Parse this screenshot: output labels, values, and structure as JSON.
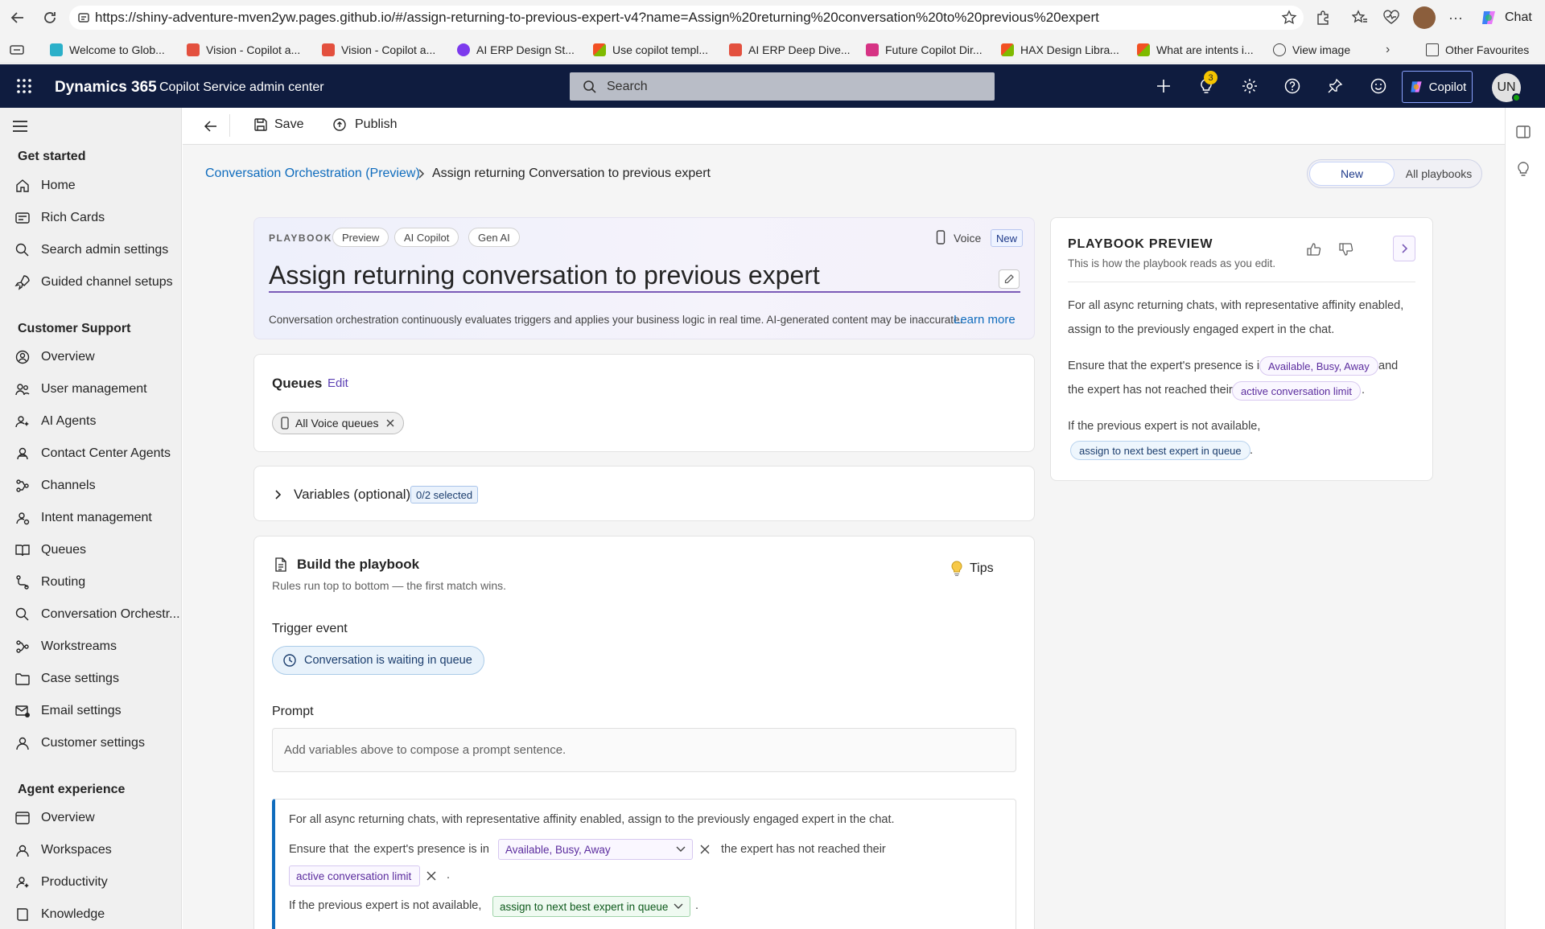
{
  "browser": {
    "url": "https://shiny-adventure-mven2yw.pages.github.io/#/assign-returning-to-previous-expert-v4?name=Assign%20returning%20conversation%20to%20previous%20expert",
    "chat_label": "Chat",
    "bookmarks": [
      {
        "label": "Welcome to Glob...",
        "color": "#2bb0c9"
      },
      {
        "label": "Vision - Copilot a...",
        "color": "#e3503e"
      },
      {
        "label": "Vision - Copilot a...",
        "color": "#e3503e"
      },
      {
        "label": "AI ERP Design St...",
        "color": "#7c3aed"
      },
      {
        "label": "Use copilot templ...",
        "color": "#f25022"
      },
      {
        "label": "AI ERP Deep Dive...",
        "color": "#e3503e"
      },
      {
        "label": "Future Copilot Dir...",
        "color": "#d63384"
      },
      {
        "label": "HAX Design Libra...",
        "color": "#f25022"
      },
      {
        "label": "What are intents i...",
        "color": "#f25022"
      },
      {
        "label": "View image",
        "color": "#424242"
      }
    ],
    "other_favourites": "Other Favourites",
    "notification_count": "3"
  },
  "header": {
    "product": "Dynamics 365",
    "app": "Copilot Service admin center",
    "search_placeholder": "Search",
    "copilot_label": "Copilot",
    "avatar_initials": "UN"
  },
  "sidebar": {
    "sections": [
      {
        "title": "Get started",
        "items": [
          "Home",
          "Rich Cards",
          "Search admin settings",
          "Guided channel setups"
        ]
      },
      {
        "title": "Customer Support",
        "items": [
          "Overview",
          "User management",
          "AI Agents",
          "Contact Center Agents",
          "Channels",
          "Intent management",
          "Queues",
          "Routing",
          "Conversation Orchestr...",
          "Workstreams",
          "Case settings",
          "Email settings",
          "Customer settings"
        ]
      },
      {
        "title": "Agent experience",
        "items": [
          "Overview",
          "Workspaces",
          "Productivity",
          "Knowledge"
        ]
      }
    ]
  },
  "commands": {
    "save": "Save",
    "publish": "Publish"
  },
  "breadcrumb": {
    "parent": "Conversation Orchestration (Preview)",
    "current": "Assign returning Conversation to previous expert"
  },
  "toggle": {
    "new": "New",
    "all": "All playbooks",
    "selected": "New"
  },
  "hero": {
    "label": "PLAYBOOK",
    "pills": [
      "Preview",
      "AI Copilot",
      "Gen AI"
    ],
    "channel": "Voice",
    "badge": "New",
    "title": "Assign returning conversation to previous expert",
    "description": "Conversation orchestration continuously evaluates triggers and applies your business logic in real time. AI-generated content may be inaccurate.",
    "learn_more": "Learn more"
  },
  "preview": {
    "title": "PLAYBOOK PREVIEW",
    "subtitle": "This is how the playbook reads as you edit.",
    "line1a": "For all async returning chats, with representative affinity enabled,",
    "line1b": "assign to the previously engaged expert in the chat.",
    "line2a": "Ensure that the expert's presence is in",
    "presence_tag": "Available, Busy, Away",
    "line2b": "and",
    "line2c": "the expert has not reached their",
    "limit_tag": "active conversation limit",
    "period": ".",
    "line3": "If the previous expert is not available,",
    "fallback_tag": "assign to next best expert in queue"
  },
  "queues": {
    "title": "Queues",
    "edit": "Edit",
    "chip": "All Voice queues"
  },
  "variables": {
    "title": "Variables (optional)",
    "badge": "0/2 selected"
  },
  "build": {
    "title": "Build the playbook",
    "subtitle": "Rules run top to bottom — the first match wins.",
    "tips": "Tips",
    "trigger_label": "Trigger event",
    "trigger_value": "Conversation is waiting in queue",
    "prompt_label": "Prompt",
    "prompt_placeholder": "Add variables above to compose a prompt sentence.",
    "rule": {
      "line1": "For all async returning chats, with representative affinity enabled, assign to the previously engaged expert in the chat.",
      "ensure": "Ensure that",
      "presence_text": "the expert's presence is in",
      "presence_value": "Available, Busy, Away",
      "limit_text": "the expert has not reached their",
      "limit_value": "active conversation limit",
      "period": ".",
      "fallback_text": "If the previous expert is not available,",
      "fallback_value": "assign to next best expert in queue"
    }
  }
}
